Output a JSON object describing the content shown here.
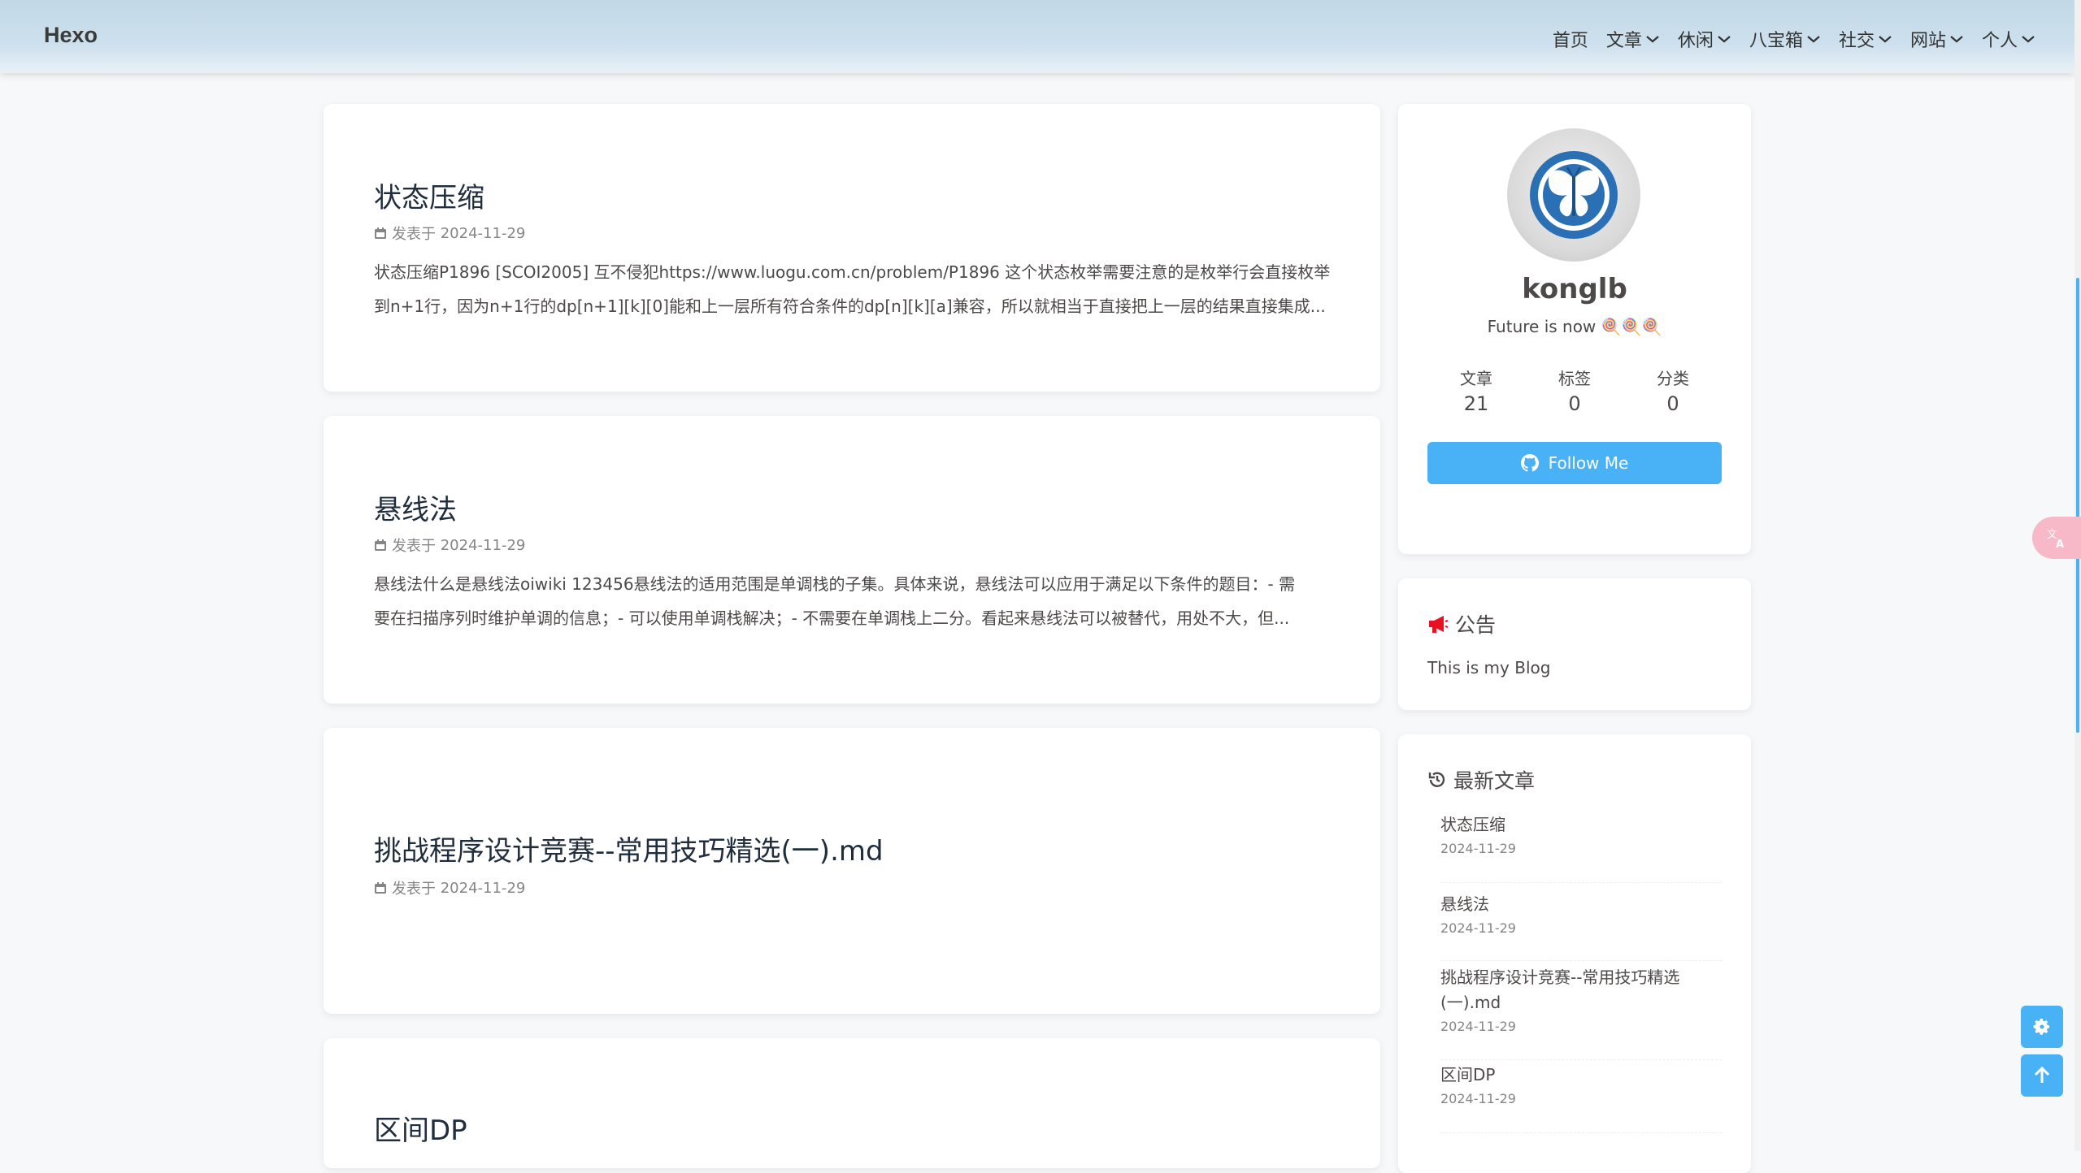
{
  "header": {
    "brand": "Hexo",
    "menu": [
      {
        "label": "首页",
        "dropdown": false
      },
      {
        "label": "文章",
        "dropdown": true
      },
      {
        "label": "休闲",
        "dropdown": true
      },
      {
        "label": "八宝箱",
        "dropdown": true
      },
      {
        "label": "社交",
        "dropdown": true
      },
      {
        "label": "网站",
        "dropdown": true
      },
      {
        "label": "个人",
        "dropdown": true
      }
    ]
  },
  "posts": [
    {
      "title": "状态压缩",
      "meta_prefix": "发表于",
      "date": "2024-11-29",
      "excerpt_lines": [
        "状态压缩P1896 [SCOI2005] 互不侵犯https://www.luogu.com.cn/problem/P1896 这个状态枚举需要注意的是枚举行会直接枚举",
        "到n+1行，因为n+1行的dp[n+1][k][0]能和上一层所有符合条件的dp[n][k][a]兼容，所以就相当于直接把上一层的结果直接集成..."
      ]
    },
    {
      "title": "悬线法",
      "meta_prefix": "发表于",
      "date": "2024-11-29",
      "excerpt_lines": [
        "悬线法什么是悬线法oiwiki 123456悬线法的适用范围是单调栈的子集。具体来说，悬线法可以应用于满足以下条件的题目：- 需",
        "要在扫描序列时维护单调的信息；- 可以使用单调栈解决；- 不需要在单调栈上二分。看起来悬线法可以被替代，用处不大，但..."
      ]
    },
    {
      "title": "挑战程序设计竞赛--常用技巧精选(一).md",
      "meta_prefix": "发表于",
      "date": "2024-11-29",
      "excerpt_lines": []
    },
    {
      "title": "区间DP",
      "meta_prefix": "",
      "date": "",
      "excerpt_lines": []
    }
  ],
  "author": {
    "name": "konglb",
    "description": "Future is now 🍭🍭🍭",
    "stats": [
      {
        "label": "文章",
        "value": "21"
      },
      {
        "label": "标签",
        "value": "0"
      },
      {
        "label": "分类",
        "value": "0"
      }
    ],
    "follow_label": "Follow Me"
  },
  "announcement": {
    "title": "公告",
    "text": "This is my Blog"
  },
  "recent": {
    "title": "最新文章",
    "items": [
      {
        "title": "状态压缩",
        "date": "2024-11-29"
      },
      {
        "title": "悬线法",
        "date": "2024-11-29"
      },
      {
        "title": "挑战程序设计竞赛--常用技巧精选(一).md",
        "date": "2024-11-29"
      },
      {
        "title": "区间DP",
        "date": "2024-11-29"
      }
    ]
  },
  "colors": {
    "accent": "#49b1f5",
    "header_bg": "#c2d8e7",
    "announcement_icon": "#e81123",
    "translate_bg": "#f7b8c8"
  },
  "icons": {
    "settings": "gear-icon",
    "back_to_top": "arrow-up-icon",
    "translate": "translate-icon",
    "github": "github-icon"
  }
}
